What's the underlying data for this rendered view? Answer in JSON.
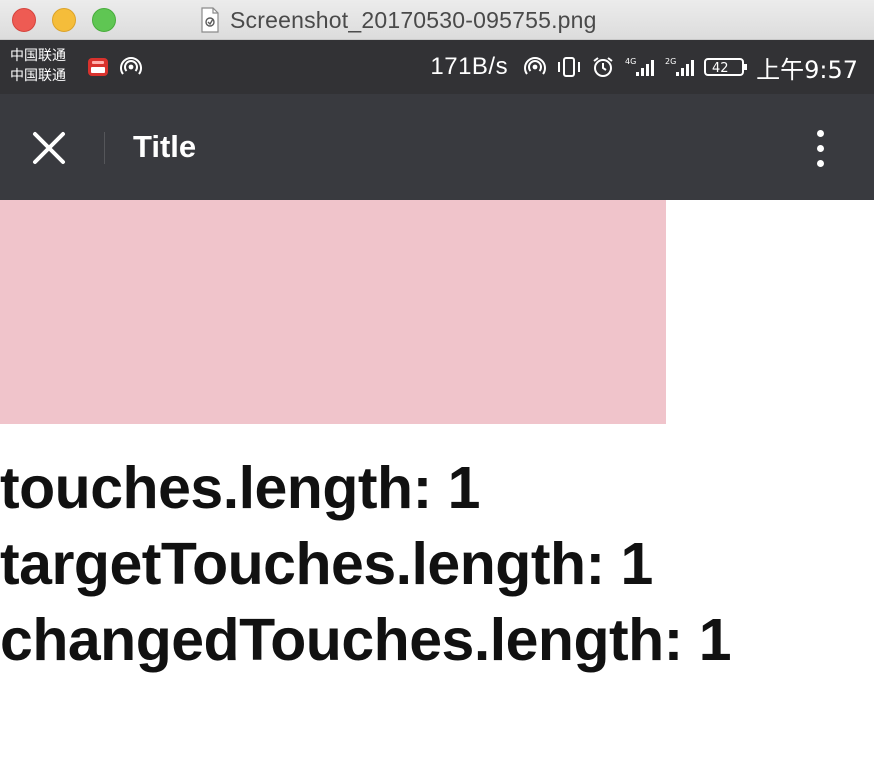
{
  "window": {
    "title": "Screenshot_20170530-095755.png"
  },
  "status_bar": {
    "carrier_1": "中国联通",
    "carrier_2": "中国联通",
    "net_speed": "171B/s",
    "signal_1_label": "4G",
    "signal_2_label": "2G",
    "battery": "42",
    "time": "上午9:57"
  },
  "action_bar": {
    "title": "Title",
    "close_icon": "close-icon",
    "more_icon": "more-vertical-icon"
  },
  "touch_area": {
    "color": "#f0c4cb"
  },
  "touch_info": {
    "touches": "touches.length: 1",
    "target_touches": "targetTouches.length: 1",
    "changed_touches": "changedTouches.length: 1"
  }
}
